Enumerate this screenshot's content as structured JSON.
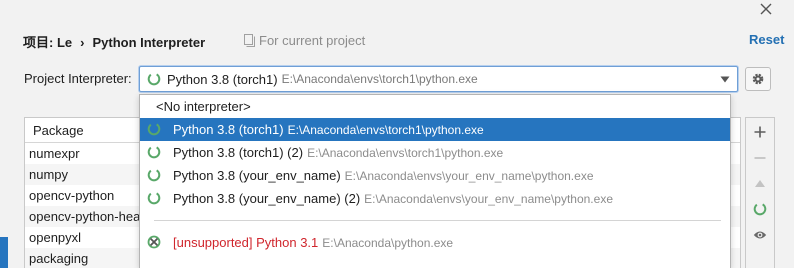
{
  "breadcrumb": {
    "project": "项目: Le",
    "separator": "›",
    "page": "Python Interpreter"
  },
  "scope": {
    "icon": "copy-icon",
    "label": "For current project"
  },
  "reset_label": "Reset",
  "interpreter": {
    "label": "Project Interpreter:",
    "selected_name": "Python 3.8 (torch1)",
    "selected_path": "E:\\Anaconda\\envs\\torch1\\python.exe"
  },
  "dropdown": {
    "items": [
      {
        "name": "<No interpreter>",
        "path": ""
      },
      {
        "name": "Python 3.8 (torch1)",
        "path": "E:\\Anaconda\\envs\\torch1\\python.exe",
        "selected": true
      },
      {
        "name": "Python 3.8 (torch1) (2)",
        "path": "E:\\Anaconda\\envs\\torch1\\python.exe"
      },
      {
        "name": "Python 3.8 (your_env_name)",
        "path": "E:\\Anaconda\\envs\\your_env_name\\python.exe"
      },
      {
        "name": "Python 3.8 (your_env_name) (2)",
        "path": "E:\\Anaconda\\envs\\your_env_name\\python.exe"
      },
      {
        "name": "[unsupported] Python 3.1",
        "path": "E:\\Anaconda\\python.exe",
        "unsupported": true
      }
    ]
  },
  "packages": {
    "header": "Package",
    "rows": [
      "numexpr",
      "numpy",
      "opencv-python",
      "opencv-python-hea",
      "openpyxl",
      "packaging"
    ]
  },
  "toolbar": {
    "icons": [
      "plus-icon",
      "minus-icon",
      "up-arrow-icon",
      "conda-icon",
      "eye-icon"
    ]
  },
  "colors": {
    "background": "#F2F2F2",
    "selection": "#2675BF",
    "link": "#2470B3",
    "env_icon": "#59A869",
    "unsupported": "#D0262D",
    "path_text": "#8C8C8C"
  }
}
